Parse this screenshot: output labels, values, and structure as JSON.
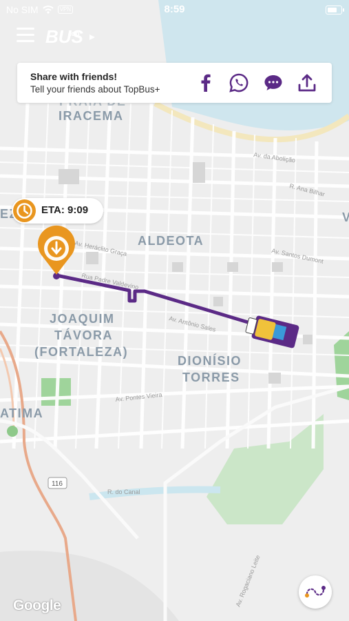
{
  "status_bar": {
    "carrier": "No SIM",
    "vpn": "VPN",
    "time": "8:59",
    "battery_level": 0.7
  },
  "header": {
    "logo_text": "BUS",
    "logo_sub": "top"
  },
  "share_card": {
    "title": "Share with friends!",
    "subtitle": "Tell your friends about TopBus+",
    "icons": [
      "facebook-icon",
      "whatsapp-icon",
      "message-icon",
      "share-upload-icon"
    ]
  },
  "eta": {
    "label": "ETA: 9:09"
  },
  "map": {
    "districts": [
      "ALDEOTA",
      "JOAQUIM",
      "TÁVORA",
      "(FORTALEZA)",
      "DIONÍSIO",
      "TORRES",
      "IRACEMA",
      "PRAIA DE",
      "ATIMA",
      "EZ",
      "V"
    ],
    "streets": [
      "Av. da Abolição",
      "R. Ana Bilhar",
      "Av. Santos Dumont",
      "Av. Heráclito Graça",
      "Rua Padre Valdevino",
      "Av. Antônio Sales",
      "Av. Pontes Vieira",
      "R. do Canal",
      "Av. Rogaciano Leite",
      "116"
    ],
    "google": "Google"
  },
  "colors": {
    "route": "#5b2a86",
    "accent": "#e9961f",
    "brand": "#5b2a86",
    "park": "#b9dfb6",
    "water": "#a9d7e8"
  }
}
